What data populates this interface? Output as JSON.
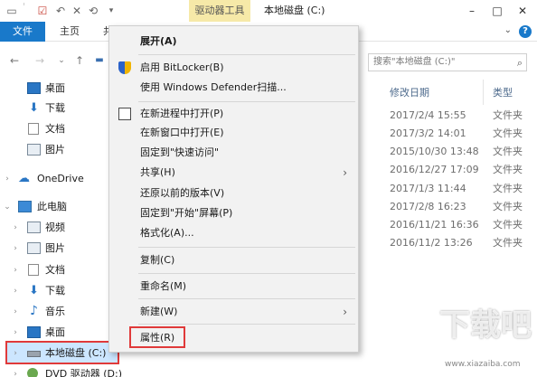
{
  "titlebar": {
    "context_tab": "驱动器工具",
    "window_title": "本地磁盘 (C:)",
    "quick_icons": [
      "folder-icon",
      "checkmark-icon",
      "undo-icon",
      "close-icon",
      "rename-icon"
    ],
    "minimize": "–",
    "maximize": "□",
    "close": "✕"
  },
  "ribbon": {
    "tabs": [
      {
        "label": "文件",
        "active": true
      },
      {
        "label": "主页",
        "active": false
      },
      {
        "label": "共",
        "active": false
      }
    ],
    "help_label": "?"
  },
  "search": {
    "placeholder": "搜索\"本地磁盘 (C:)\""
  },
  "columns": {
    "date": "修改日期",
    "type": "类型"
  },
  "files": [
    {
      "date": "2017/2/4 15:55",
      "type": "文件夹"
    },
    {
      "date": "2017/3/2 14:01",
      "type": "文件夹"
    },
    {
      "date": "2015/10/30 13:48",
      "type": "文件夹"
    },
    {
      "date": "2016/12/27 17:09",
      "type": "文件夹"
    },
    {
      "date": "2017/1/3 11:44",
      "type": "文件夹"
    },
    {
      "date": "2017/2/8 16:23",
      "type": "文件夹"
    },
    {
      "date": "2016/11/21 16:36",
      "type": "文件夹"
    },
    {
      "date": "2016/11/2 13:26",
      "type": "文件夹"
    }
  ],
  "nav": {
    "items": [
      {
        "label": "桌面",
        "icon": "desktop-icon"
      },
      {
        "label": "下载",
        "icon": "download-icon"
      },
      {
        "label": "文档",
        "icon": "document-icon"
      },
      {
        "label": "图片",
        "icon": "picture-icon"
      },
      {
        "label": "OneDrive",
        "icon": "cloud-icon"
      },
      {
        "label": "此电脑",
        "icon": "computer-icon"
      },
      {
        "label": "视频",
        "icon": "video-icon"
      },
      {
        "label": "图片",
        "icon": "picture-icon"
      },
      {
        "label": "文档",
        "icon": "document-icon"
      },
      {
        "label": "下载",
        "icon": "download-icon"
      },
      {
        "label": "音乐",
        "icon": "music-icon"
      },
      {
        "label": "桌面",
        "icon": "desktop-icon"
      },
      {
        "label": "本地磁盘 (C:)",
        "icon": "drive-icon"
      },
      {
        "label": "DVD 驱动器 (D:)",
        "icon": "dvd-icon"
      }
    ]
  },
  "menu": {
    "items": [
      {
        "label": "展开(A)"
      },
      {
        "label": "启用 BitLocker(B)"
      },
      {
        "label": "使用 Windows Defender扫描..."
      },
      {
        "label": "在新进程中打开(P)"
      },
      {
        "label": "在新窗口中打开(E)"
      },
      {
        "label": "固定到\"快速访问\""
      },
      {
        "label": "共享(H)"
      },
      {
        "label": "还原以前的版本(V)"
      },
      {
        "label": "固定到\"开始\"屏幕(P)"
      },
      {
        "label": "格式化(A)..."
      },
      {
        "label": "复制(C)"
      },
      {
        "label": "重命名(M)"
      },
      {
        "label": "新建(W)"
      },
      {
        "label": "属性(R)"
      }
    ],
    "submenu_arrow": "›"
  },
  "watermark": {
    "text": "下载吧",
    "url": "www.xiazaiba.com"
  },
  "colors": {
    "accent": "#1979ca",
    "highlight": "#e03a3a",
    "context_tab": "#f6e9a8"
  }
}
